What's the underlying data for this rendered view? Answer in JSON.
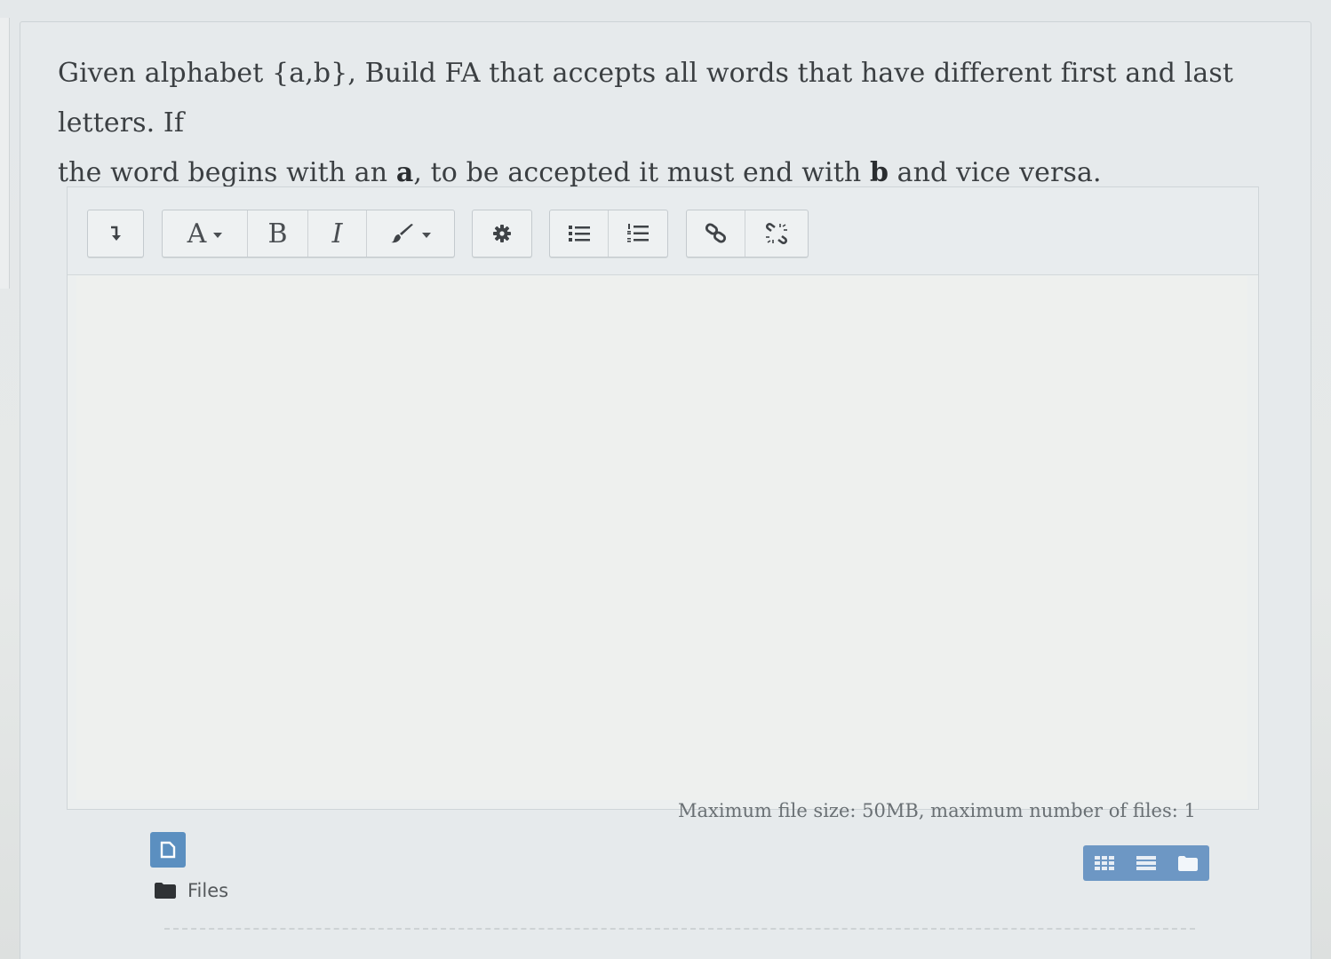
{
  "question": {
    "line1": "Given alphabet {a,b}, Build FA that accepts all words that have different first and last letters. If",
    "line2_pre": "the word begins with an ",
    "line2_bold_a": "a",
    "line2_mid": ", to be accepted it must end with ",
    "line2_bold_b": "b",
    "line2_post": " and vice versa."
  },
  "toolbar": {
    "font_label": "A",
    "bold_label": "B",
    "italic_label": "I"
  },
  "icons": {
    "collapse": "arrow-down-icon",
    "paragraph": "font-style-icon",
    "style": "paint-brush-icon",
    "settings": "gear-icon",
    "unordered": "unordered-list-icon",
    "ordered": "ordered-list-icon",
    "link": "link-icon",
    "unlink": "unlink-icon"
  },
  "attachments": {
    "limit_text": "Maximum file size: 50MB, maximum number of files: 1",
    "files_label": "Files"
  },
  "colors": {
    "accent": "#6d97c4",
    "text": "#3b3f42"
  }
}
